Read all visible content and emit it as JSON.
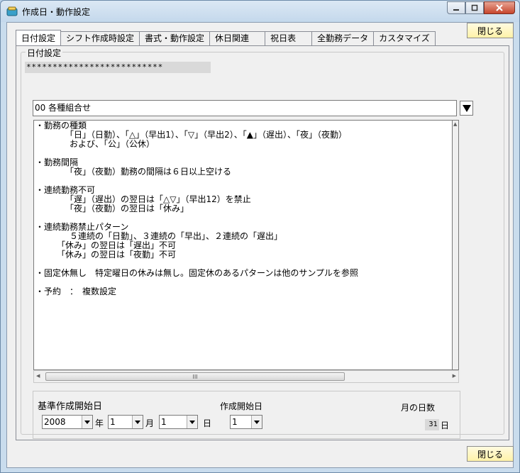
{
  "window": {
    "title": "作成日・動作設定",
    "controls": [
      "minimize-icon",
      "maximize-icon",
      "close-icon"
    ]
  },
  "close_button_label": "閉じる",
  "tabs": [
    {
      "label": "日付設定",
      "active": true
    },
    {
      "label": "シフト作成時設定",
      "active": false
    },
    {
      "label": "書式・動作設定",
      "active": false
    },
    {
      "label": "休日関連",
      "active": false
    },
    {
      "label": "祝日表",
      "active": false
    },
    {
      "label": "全勤務データ",
      "active": false
    },
    {
      "label": "カスタマイズ",
      "active": false
    }
  ],
  "date_settings": {
    "group_title": "日付設定",
    "masked_text": "**************************",
    "pattern_combo_value": "00 各種組合せ",
    "description_lines": [
      "・勤務の種類",
      "　　　　「日」（日勤）、「△」（早出1）、「▽」（早出2）、「▲」（遅出）、「夜」（夜勤）",
      "　　　　および、「公」（公休）",
      "",
      "・勤務間隔",
      "　　　　「夜」（夜勤）勤務の間隔は６日以上空ける",
      "",
      "・連続勤務不可",
      "　　　　「遅」（遅出）の翌日は「△▽」（早出12）を禁止",
      "　　　　「夜」（夜勤）の翌日は「休み」",
      "",
      "・連続勤務禁止パターン",
      "　　　　５連続の「日勤」、３連続の「早出」、２連続の「遅出」",
      "　　　「休み」の翌日は「遅出」不可",
      "　　　「休み」の翌日は「夜勤」不可",
      "",
      "・固定休無し　特定曜日の休みは無し。固定休のあるパターンは他のサンプルを参照",
      "",
      "・予約　：　複数設定"
    ],
    "scroll_thumb_glyph": "III"
  },
  "start_date": {
    "base_label": "基準作成開始日",
    "year_value": "2008",
    "year_unit": "年",
    "month_value": "1",
    "month_unit": "月",
    "day_value": "1",
    "day_unit": "日",
    "creation_start_label": "作成開始日",
    "creation_start_value": "1",
    "days_in_month_label": "月の日数",
    "days_in_month_value": "31",
    "days_in_month_unit": "日"
  }
}
